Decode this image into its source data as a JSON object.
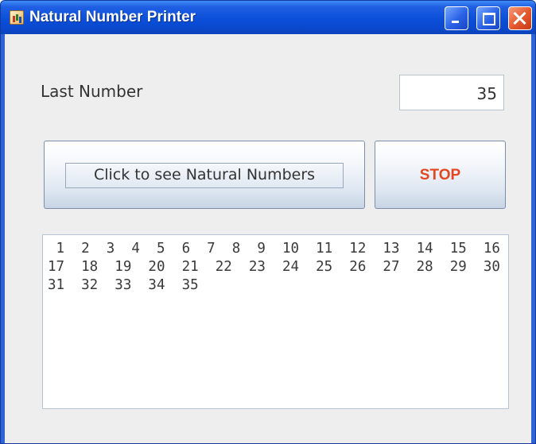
{
  "window": {
    "title": "Natural Number Printer",
    "titlebar_color": "#0b4fd9",
    "icon": "java-app-icon"
  },
  "last_number": {
    "label": "Last Number",
    "value": "35"
  },
  "buttons": {
    "start_label": "Click to see Natural Numbers",
    "stop_label": "STOP",
    "stop_color": "#e3471f"
  },
  "output": {
    "text": " 1  2  3  4  5  6  7  8  9  10  11  12  13  14  15  16\n17  18  19  20  21  22  23  24  25  26  27  28  29  30\n31  32  33  34  35"
  }
}
